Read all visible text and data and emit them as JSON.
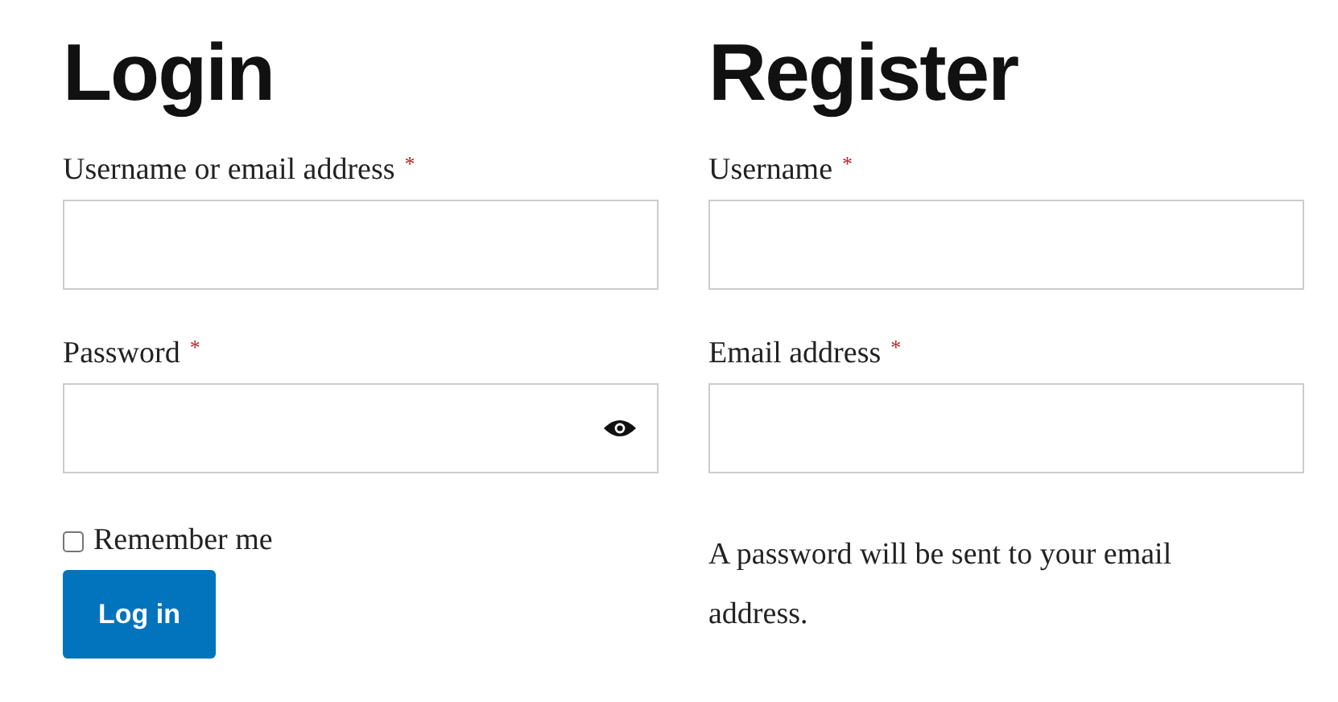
{
  "login": {
    "title": "Login",
    "fields": [
      {
        "label": "Username or email address",
        "required_mark": "*",
        "kind": "text"
      },
      {
        "label": "Password",
        "required_mark": "*",
        "kind": "password"
      }
    ],
    "remember": {
      "label": "Remember me",
      "checked": false
    },
    "button": "Log in"
  },
  "register": {
    "title": "Register",
    "fields": [
      {
        "label": "Username",
        "required_mark": "*",
        "kind": "text"
      },
      {
        "label": "Email address",
        "required_mark": "*",
        "kind": "text"
      }
    ],
    "note": "A password will be sent to your email address."
  }
}
